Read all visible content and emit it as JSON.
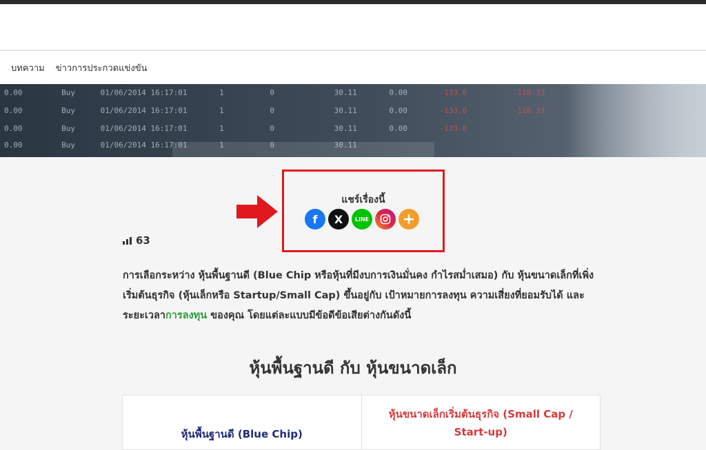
{
  "nav": {
    "items": [
      "บทความ",
      "ข่าวการประกวดแข่งขัน"
    ]
  },
  "hero": {
    "rows": [
      {
        "a": "0.00",
        "b": "Buy",
        "c": "01/06/2014 16:17:01",
        "d": "1",
        "e": "0",
        "f": "30.11",
        "g": "0.00",
        "h": "-133.0",
        "i": "-118.33"
      },
      {
        "a": "0.00",
        "b": "Buy",
        "c": "01/06/2014 16:17:01",
        "d": "1",
        "e": "0",
        "f": "30.11",
        "g": "0.00",
        "h": "-133.0",
        "i": "-118.33"
      },
      {
        "a": "0.00",
        "b": "Buy",
        "c": "01/06/2014 16:17:01",
        "d": "1",
        "e": "0",
        "f": "30.11",
        "g": "0.00",
        "h": "-133.0",
        "i": ""
      },
      {
        "a": "0.00",
        "b": "Buy",
        "c": "01/06/2014 16:17:01",
        "d": "1",
        "e": "0",
        "f": "30.11",
        "g": "0.00",
        "h": "",
        "i": ""
      }
    ]
  },
  "share": {
    "title": "แชร์เรื่องนี้",
    "icons": [
      "facebook-icon",
      "x-icon",
      "line-icon",
      "instagram-icon",
      "more-icon"
    ],
    "line_label": "LINE"
  },
  "views": {
    "count": "63"
  },
  "article": {
    "para_part1": "การเลือกระหว่าง หุ้นพื้นฐานดี (Blue Chip หรือหุ้นที่มีงบการเงินมั่นคง กำไรสม่ำเสมอ) กับ หุ้นขนาดเล็กที่เพิ่งเริ่มต้นธุรกิจ (หุ้นเล็กหรือ Startup/Small Cap) ขึ้นอยู่กับ เป้าหมายการลงทุน ความเสี่ยงที่ยอมรับได้ และระยะเวลา",
    "para_link": "การลงทุน",
    "para_part2": " ของคุณ โดยแต่ละแบบมีข้อดีข้อเสียต่างกันดังนี้",
    "heading": "หุ้นพื้นฐานดี กับ หุ้นขนาดเล็ก"
  },
  "table": {
    "col1": "หุ้นพื้นฐานดี (Blue Chip)",
    "col2": "หุ้นขนาดเล็กเริ่มต้นธุรกิจ (Small Cap / Start-up)"
  },
  "colors": {
    "highlight_border": "#e0191e",
    "link": "#2a9d3c",
    "col1_text": "#1f2a7a",
    "col2_text": "#d63a3a"
  }
}
